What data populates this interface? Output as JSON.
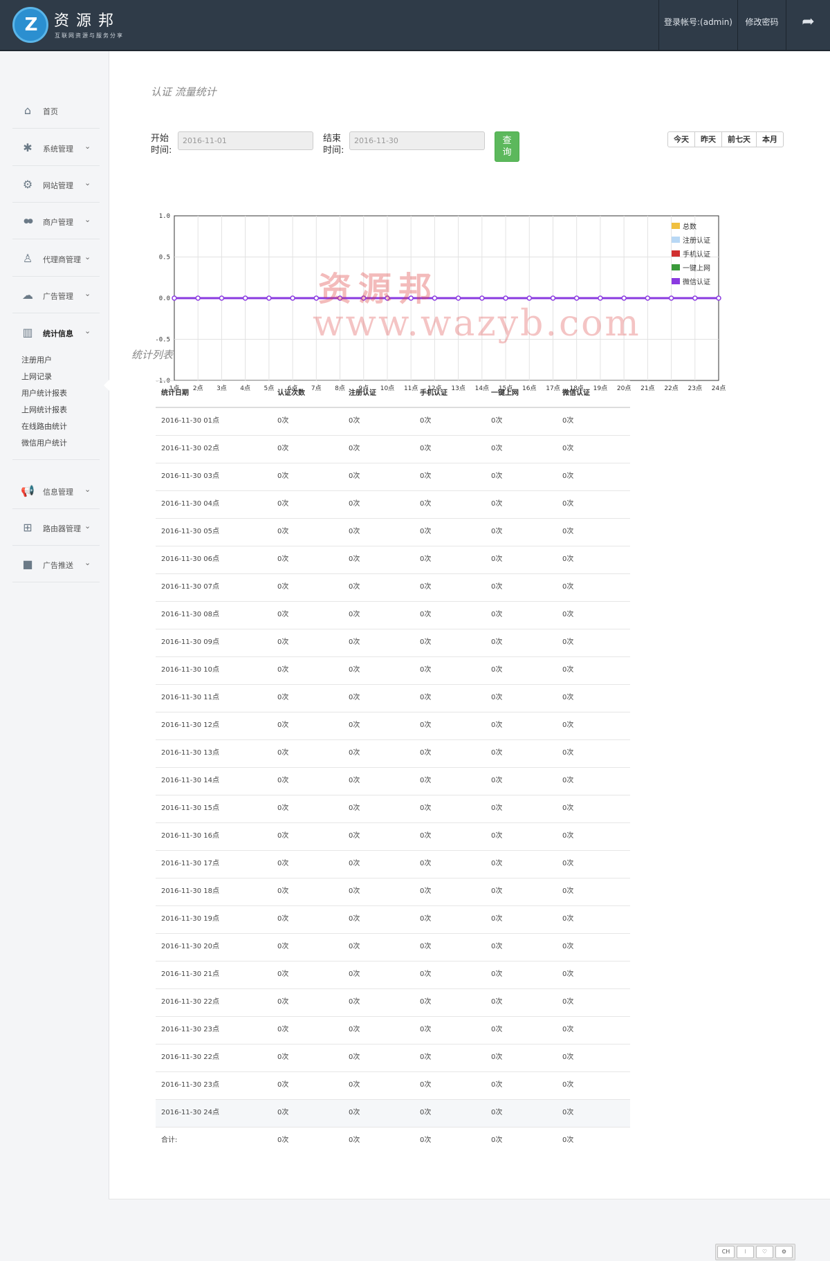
{
  "header": {
    "brand": "资源邦",
    "tagline": "互联网资源与服务分享",
    "login_account": "登录帐号:(admin)",
    "change_password": "修改密码",
    "logo_letter": "Z",
    "exit_icon": "share-icon"
  },
  "sidebar": {
    "items": [
      {
        "label": "首页",
        "icon": "home-icon"
      },
      {
        "label": "系统管理",
        "icon": "asterisk-icon"
      },
      {
        "label": "网站管理",
        "icon": "cogs-icon"
      },
      {
        "label": "商户管理",
        "icon": "users-icon"
      },
      {
        "label": "代理商管理",
        "icon": "user-icon"
      },
      {
        "label": "广告管理",
        "icon": "cloud-icon"
      },
      {
        "label": "统计信息",
        "icon": "bar-chart-icon"
      },
      {
        "label": "信息管理",
        "icon": "bullhorn-icon"
      },
      {
        "label": "路由器管理",
        "icon": "sitemap-icon"
      },
      {
        "label": "广告推送",
        "icon": "video-camera-icon"
      }
    ],
    "sub_items": [
      "注册用户",
      "上网记录",
      "用户统计报表",
      "上网统计报表",
      "在线路由统计",
      "微信用户统计"
    ]
  },
  "page": {
    "title": "认证 流量统计",
    "start_label_1": "开始",
    "start_label_2": "时间:",
    "start_value": "2016-11-01",
    "end_label_1": "结束",
    "end_label_2": "时间:",
    "end_value": "2016-11-30",
    "query_1": "查",
    "query_2": "询",
    "ranges": [
      "今天",
      "昨天",
      "前七天",
      "本月"
    ],
    "list_title": "统计列表"
  },
  "chart_data": {
    "type": "line",
    "title": "",
    "x": [
      "1点",
      "2点",
      "3点",
      "4点",
      "5点",
      "6点",
      "7点",
      "8点",
      "9点",
      "10点",
      "11点",
      "12点",
      "13点",
      "14点",
      "15点",
      "16点",
      "17点",
      "18点",
      "19点",
      "20点",
      "21点",
      "22点",
      "23点",
      "24点"
    ],
    "ylim": [
      -1.0,
      1.0
    ],
    "yticks": [
      "1.0",
      "0.5",
      "0.0",
      "-0.5",
      "-1.0"
    ],
    "grid": true,
    "legend_position": "top-right",
    "series": [
      {
        "name": "总数",
        "color": "#f0c040",
        "values": [
          0,
          0,
          0,
          0,
          0,
          0,
          0,
          0,
          0,
          0,
          0,
          0,
          0,
          0,
          0,
          0,
          0,
          0,
          0,
          0,
          0,
          0,
          0,
          0
        ]
      },
      {
        "name": "注册认证",
        "color": "#b8d8f5",
        "values": [
          0,
          0,
          0,
          0,
          0,
          0,
          0,
          0,
          0,
          0,
          0,
          0,
          0,
          0,
          0,
          0,
          0,
          0,
          0,
          0,
          0,
          0,
          0,
          0
        ]
      },
      {
        "name": "手机认证",
        "color": "#d03030",
        "values": [
          0,
          0,
          0,
          0,
          0,
          0,
          0,
          0,
          0,
          0,
          0,
          0,
          0,
          0,
          0,
          0,
          0,
          0,
          0,
          0,
          0,
          0,
          0,
          0
        ]
      },
      {
        "name": "一键上网",
        "color": "#3a9a3a",
        "values": [
          0,
          0,
          0,
          0,
          0,
          0,
          0,
          0,
          0,
          0,
          0,
          0,
          0,
          0,
          0,
          0,
          0,
          0,
          0,
          0,
          0,
          0,
          0,
          0
        ]
      },
      {
        "name": "微信认证",
        "color": "#8a3ae0",
        "values": [
          0,
          0,
          0,
          0,
          0,
          0,
          0,
          0,
          0,
          0,
          0,
          0,
          0,
          0,
          0,
          0,
          0,
          0,
          0,
          0,
          0,
          0,
          0,
          0
        ]
      }
    ]
  },
  "table": {
    "headers": [
      "统计日期",
      "认证次数",
      "注册认证",
      "手机认证",
      "一键上网",
      "微信认证"
    ],
    "rows": [
      [
        "2016-11-30 01点",
        "0次",
        "0次",
        "0次",
        "0次",
        "0次"
      ],
      [
        "2016-11-30 02点",
        "0次",
        "0次",
        "0次",
        "0次",
        "0次"
      ],
      [
        "2016-11-30 03点",
        "0次",
        "0次",
        "0次",
        "0次",
        "0次"
      ],
      [
        "2016-11-30 04点",
        "0次",
        "0次",
        "0次",
        "0次",
        "0次"
      ],
      [
        "2016-11-30 05点",
        "0次",
        "0次",
        "0次",
        "0次",
        "0次"
      ],
      [
        "2016-11-30 06点",
        "0次",
        "0次",
        "0次",
        "0次",
        "0次"
      ],
      [
        "2016-11-30 07点",
        "0次",
        "0次",
        "0次",
        "0次",
        "0次"
      ],
      [
        "2016-11-30 08点",
        "0次",
        "0次",
        "0次",
        "0次",
        "0次"
      ],
      [
        "2016-11-30 09点",
        "0次",
        "0次",
        "0次",
        "0次",
        "0次"
      ],
      [
        "2016-11-30 10点",
        "0次",
        "0次",
        "0次",
        "0次",
        "0次"
      ],
      [
        "2016-11-30 11点",
        "0次",
        "0次",
        "0次",
        "0次",
        "0次"
      ],
      [
        "2016-11-30 12点",
        "0次",
        "0次",
        "0次",
        "0次",
        "0次"
      ],
      [
        "2016-11-30 13点",
        "0次",
        "0次",
        "0次",
        "0次",
        "0次"
      ],
      [
        "2016-11-30 14点",
        "0次",
        "0次",
        "0次",
        "0次",
        "0次"
      ],
      [
        "2016-11-30 15点",
        "0次",
        "0次",
        "0次",
        "0次",
        "0次"
      ],
      [
        "2016-11-30 16点",
        "0次",
        "0次",
        "0次",
        "0次",
        "0次"
      ],
      [
        "2016-11-30 17点",
        "0次",
        "0次",
        "0次",
        "0次",
        "0次"
      ],
      [
        "2016-11-30 18点",
        "0次",
        "0次",
        "0次",
        "0次",
        "0次"
      ],
      [
        "2016-11-30 19点",
        "0次",
        "0次",
        "0次",
        "0次",
        "0次"
      ],
      [
        "2016-11-30 20点",
        "0次",
        "0次",
        "0次",
        "0次",
        "0次"
      ],
      [
        "2016-11-30 21点",
        "0次",
        "0次",
        "0次",
        "0次",
        "0次"
      ],
      [
        "2016-11-30 22点",
        "0次",
        "0次",
        "0次",
        "0次",
        "0次"
      ],
      [
        "2016-11-30 23点",
        "0次",
        "0次",
        "0次",
        "0次",
        "0次"
      ],
      [
        "2016-11-30 22点",
        "0次",
        "0次",
        "0次",
        "0次",
        "0次"
      ],
      [
        "2016-11-30 23点",
        "0次",
        "0次",
        "0次",
        "0次",
        "0次"
      ],
      [
        "2016-11-30 24点",
        "0次",
        "0次",
        "0次",
        "0次",
        "0次"
      ]
    ],
    "total": [
      "合计:",
      "0次",
      "0次",
      "0次",
      "0次",
      "0次"
    ]
  },
  "watermark": {
    "line1": "资源邦",
    "line2": "www.wazyb.com"
  },
  "tray": [
    "CH",
    "⁝",
    "♡",
    "⚙"
  ],
  "colors": {
    "header_bg": "#2f3b48",
    "query_green": "#5cb85c",
    "series_line": "#8a3ae0"
  }
}
